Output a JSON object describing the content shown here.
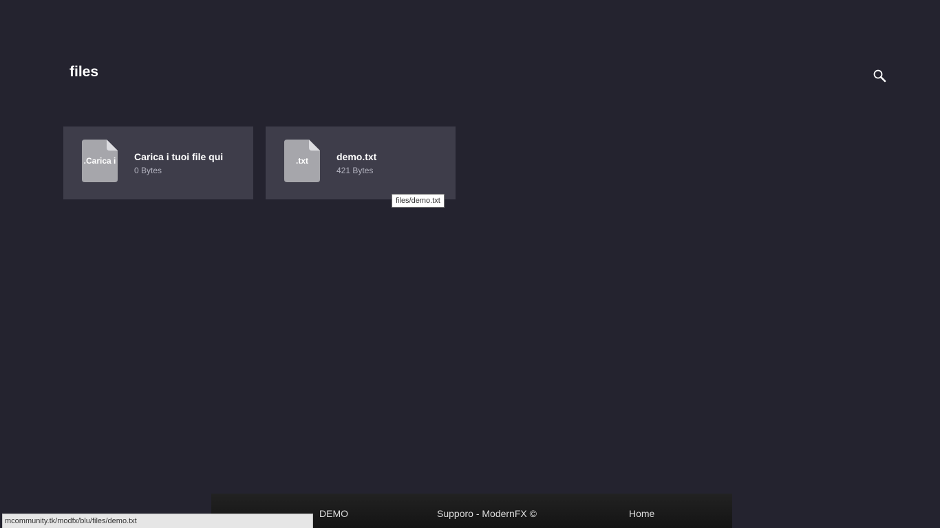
{
  "header": {
    "title": "files",
    "search_icon": "search-icon"
  },
  "files": [
    {
      "ext": ".Carica i",
      "name": "Carica i tuoi file qui",
      "size": "0 Bytes",
      "icon": "file-icon"
    },
    {
      "ext": ".txt",
      "name": "demo.txt",
      "size": "421 Bytes",
      "icon": "file-icon"
    }
  ],
  "tooltip": {
    "text": "files/demo.txt"
  },
  "footer": {
    "demo_label": "DEMO",
    "support_label": "Supporo - ModernFX ©",
    "home_label": "Home"
  },
  "status_bar": {
    "url": "mcommunity.tk/modfx/blu/files/demo.txt"
  },
  "colors": {
    "background": "#24232f",
    "card": "#3e3d4a",
    "file_icon": "#a6a6ab"
  }
}
